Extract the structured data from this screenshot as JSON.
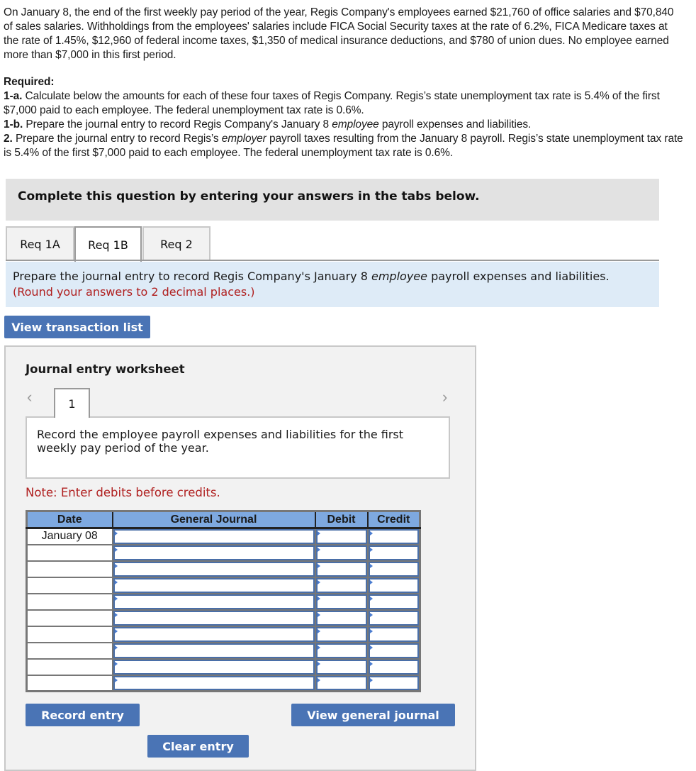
{
  "problem": {
    "text": "On January 8, the end of the first weekly pay period of the year, Regis Company's employees earned $21,760 of office salaries and $70,840 of sales salaries. Withholdings from the employees' salaries include FICA Social Security taxes at the rate of 6.2%, FICA Medicare taxes at the rate of 1.45%, $12,960 of federal income taxes, $1,350 of medical insurance deductions, and $780 of union dues. No employee earned more than $7,000 in this first period.",
    "required_label": "Required:",
    "req_1a_label": "1-a.",
    "req_1a_text": " Calculate below the amounts for each of these four taxes of Regis Company. Regis’s state unemployment tax rate is 5.4% of the first $7,000 paid to each employee. The federal unemployment tax rate is 0.6%.",
    "req_1b_label": "1-b.",
    "req_1b_pre": " Prepare the journal entry to record Regis Company's January 8 ",
    "req_1b_em": "employee",
    "req_1b_post": " payroll expenses and liabilities.",
    "req_2_label": "2.",
    "req_2_pre": " Prepare the journal entry to record Regis’s ",
    "req_2_em": "employer",
    "req_2_post": " payroll taxes resulting from the January 8 payroll. Regis’s state unemployment tax rate is 5.4% of the first $7,000 paid to each employee. The federal unemployment tax rate is 0.6%."
  },
  "banner": {
    "text": "Complete this question by entering your answers in the tabs below."
  },
  "tabs": [
    {
      "label": "Req 1A",
      "active": false
    },
    {
      "label": "Req 1B",
      "active": true
    },
    {
      "label": "Req 2",
      "active": false
    }
  ],
  "instruction": {
    "pre": "Prepare the journal entry to record Regis Company's January 8 ",
    "em": "employee",
    "post": " payroll expenses and liabilities. ",
    "hint": "(Round your answers to 2 decimal places.)"
  },
  "buttons": {
    "view_transaction_list": "View transaction list",
    "record_entry": "Record entry",
    "view_general_journal": "View general journal",
    "clear_entry": "Clear entry"
  },
  "worksheet": {
    "title": "Journal entry worksheet",
    "prev_icon": "chevron-left-icon",
    "next_icon": "chevron-right-icon",
    "current_entry": "1",
    "description": "Record the employee payroll expenses and liabilities for the first weekly pay period of the year.",
    "note": "Note: Enter debits before credits."
  },
  "journal": {
    "headers": {
      "date": "Date",
      "account": "General Journal",
      "debit": "Debit",
      "credit": "Credit"
    },
    "rows": [
      {
        "date": "January 08",
        "account": "",
        "debit": "",
        "credit": ""
      },
      {
        "date": "",
        "account": "",
        "debit": "",
        "credit": ""
      },
      {
        "date": "",
        "account": "",
        "debit": "",
        "credit": ""
      },
      {
        "date": "",
        "account": "",
        "debit": "",
        "credit": ""
      },
      {
        "date": "",
        "account": "",
        "debit": "",
        "credit": ""
      },
      {
        "date": "",
        "account": "",
        "debit": "",
        "credit": ""
      },
      {
        "date": "",
        "account": "",
        "debit": "",
        "credit": ""
      },
      {
        "date": "",
        "account": "",
        "debit": "",
        "credit": ""
      },
      {
        "date": "",
        "account": "",
        "debit": "",
        "credit": ""
      },
      {
        "date": "",
        "account": "",
        "debit": "",
        "credit": ""
      }
    ]
  },
  "colors": {
    "button_blue": "#4a74b5",
    "note_red": "#b02020",
    "header_blue": "#7ea9e0",
    "instruction_bg": "#deebf7"
  }
}
